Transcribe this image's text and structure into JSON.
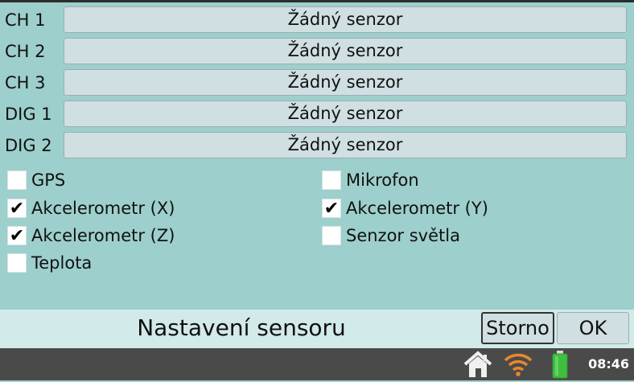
{
  "channels": [
    {
      "label": "CH 1",
      "sensor": "Žádný senzor"
    },
    {
      "label": "CH 2",
      "sensor": "Žádný senzor"
    },
    {
      "label": "CH 3",
      "sensor": "Žádný senzor"
    },
    {
      "label": "DIG 1",
      "sensor": "Žádný senzor"
    },
    {
      "label": "DIG 2",
      "sensor": "Žádný senzor"
    }
  ],
  "internal_sensors": {
    "gps": {
      "label": "GPS",
      "checked": false
    },
    "mikrofon": {
      "label": "Mikrofon",
      "checked": false
    },
    "accel_x": {
      "label": "Akcelerometr (X)",
      "checked": true
    },
    "accel_y": {
      "label": "Akcelerometr (Y)",
      "checked": true
    },
    "accel_z": {
      "label": "Akcelerometr (Z)",
      "checked": true
    },
    "light": {
      "label": "Senzor světla",
      "checked": false
    },
    "teplota": {
      "label": "Teplota",
      "checked": false
    }
  },
  "footer": {
    "title": "Nastavení sensoru",
    "cancel_label": "Storno",
    "ok_label": "OK"
  },
  "statusbar": {
    "time": "08:46",
    "icons": [
      "home-icon",
      "wifi-icon",
      "battery-icon"
    ],
    "wifi_color": "#e8892a",
    "battery_color": "#3fbf3f"
  },
  "checkmark": "✔"
}
